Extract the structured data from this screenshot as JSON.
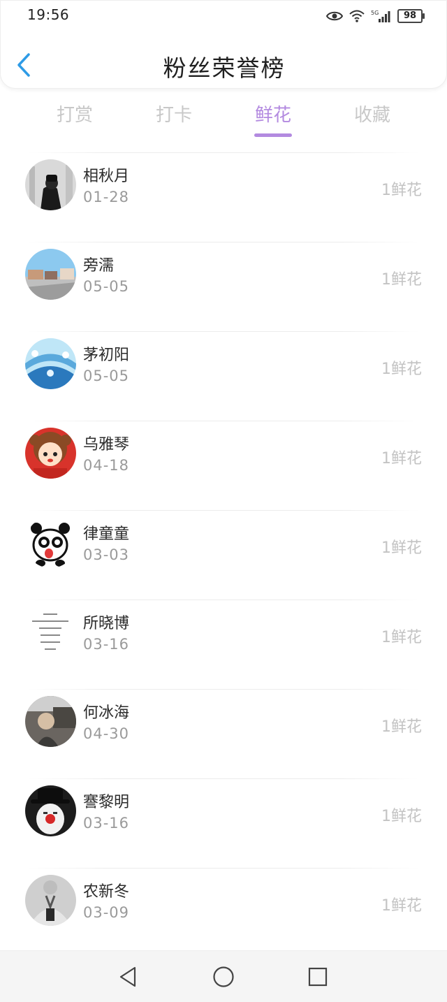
{
  "status_bar": {
    "time": "19:56",
    "signal_label": "5G",
    "battery": "98"
  },
  "header": {
    "title": "粉丝荣誉榜",
    "back_icon": "chevron-left-icon",
    "accent_color": "#2e9be6"
  },
  "tabs": [
    {
      "label": "打赏",
      "active": false
    },
    {
      "label": "打卡",
      "active": false
    },
    {
      "label": "鲜花",
      "active": true
    },
    {
      "label": "收藏",
      "active": false
    }
  ],
  "tab_active_color": "#b38ae0",
  "fans": [
    {
      "name": "相秋月",
      "date": "01-28",
      "count": "1鲜花"
    },
    {
      "name": "旁濡",
      "date": "05-05",
      "count": "1鲜花"
    },
    {
      "name": "茅初阳",
      "date": "05-05",
      "count": "1鲜花"
    },
    {
      "name": "乌雅琴",
      "date": "04-18",
      "count": "1鲜花"
    },
    {
      "name": "律童童",
      "date": "03-03",
      "count": "1鲜花"
    },
    {
      "name": "所晓博",
      "date": "03-16",
      "count": "1鲜花"
    },
    {
      "name": "何冰海",
      "date": "04-30",
      "count": "1鲜花"
    },
    {
      "name": "謇黎明",
      "date": "03-16",
      "count": "1鲜花"
    },
    {
      "name": "农新冬",
      "date": "03-09",
      "count": "1鲜花"
    }
  ],
  "nav_bar": {
    "back": "triangle-back-icon",
    "home": "circle-home-icon",
    "recents": "square-recents-icon"
  }
}
